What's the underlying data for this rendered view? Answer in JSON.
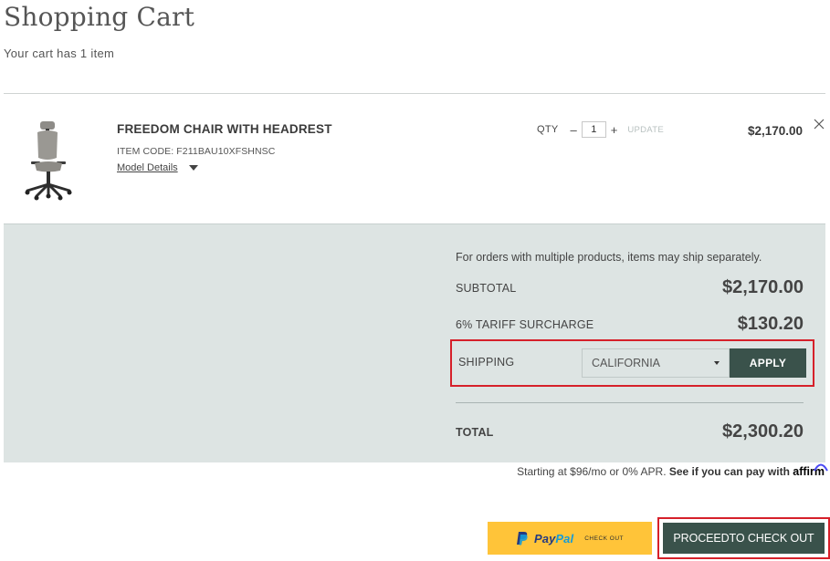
{
  "page": {
    "title": "Shopping Cart",
    "subtitle": "Your cart has 1 item"
  },
  "cart_item": {
    "name": "FREEDOM CHAIR WITH HEADREST",
    "item_code": "ITEM CODE: F211BAU10XFSHNSC",
    "model_details_label": "Model Details",
    "qty_label": "QTY",
    "qty_decrease": "–",
    "qty_value": "1",
    "qty_increase": "+",
    "update_label": "UPDATE",
    "price": "$2,170.00",
    "remove_icon": "close-icon",
    "image_icon": "office-chair-image"
  },
  "summary": {
    "note": "For orders with multiple products, items may ship separately.",
    "subtotal_label": "SUBTOTAL",
    "subtotal_value": "$2,170.00",
    "tariff_label": "6% TARIFF SURCHARGE",
    "tariff_value": "$130.20",
    "shipping_label": "SHIPPING",
    "shipping_selected": "CALIFORNIA",
    "apply_label": "APPLY",
    "total_label": "TOTAL",
    "total_value": "$2,300.20"
  },
  "financing": {
    "text": "Starting at $96/mo or 0% APR.",
    "cta": "See if you can pay with",
    "brand": "affirm"
  },
  "actions": {
    "paypal_word_pay": "Pay",
    "paypal_word_pal": "Pal",
    "paypal_checkout": "CHECK OUT",
    "proceed_label": "PROCEEDTO CHECK OUT"
  },
  "colors": {
    "summary_bg": "#dde4e3",
    "primary_button": "#3a524b",
    "paypal_yellow": "#ffc439",
    "highlight_red": "#d6202a"
  }
}
